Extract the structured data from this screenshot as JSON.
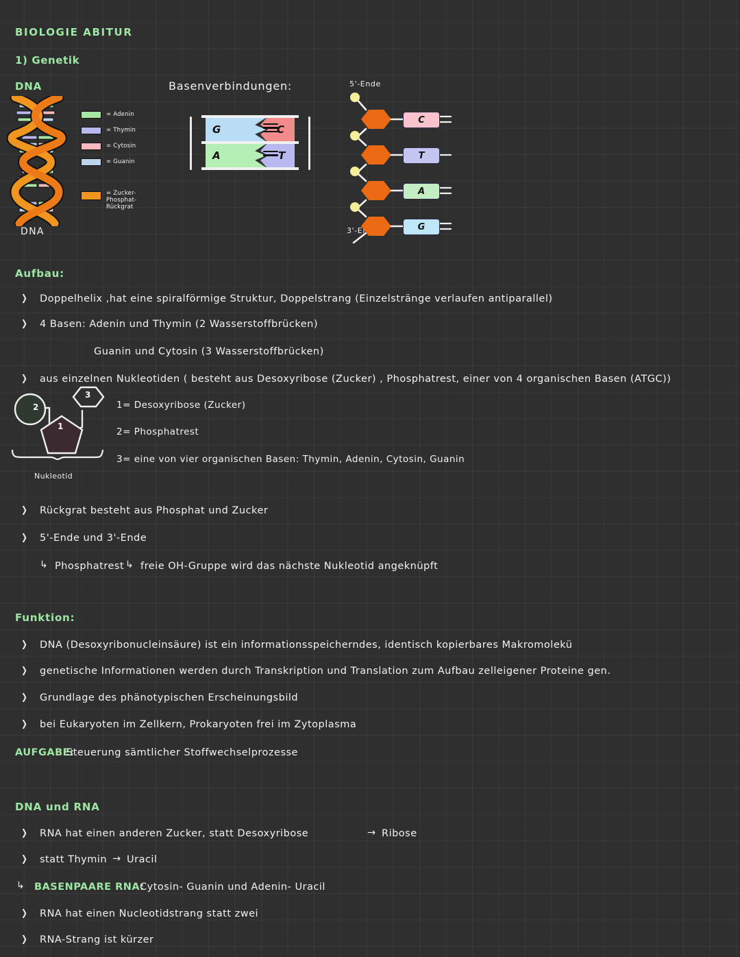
{
  "page": {
    "title": "BIOLOGIE ABITUR",
    "chapter": "1) Genetik"
  },
  "colors": {
    "background": "#2f2f2f",
    "grid_line": "#3d3d3d",
    "heading_green": "#9ee6a3",
    "text_white": "#f2f2f2",
    "adenin": "#a8e6a3",
    "thymin": "#b9b9ef",
    "cytosin": "#f5b9bf",
    "guanin": "#bcd4ec",
    "backbone_orange": "#ec6a14",
    "phosphate_yellow": "#f5ee9a",
    "cytosin_box": "#f9c3cc",
    "guanin_box": "#bfe7f7"
  },
  "dna_diagram": {
    "heading": "DNA",
    "caption": "DNA",
    "legend": [
      {
        "label": "= Adenin",
        "color": "#a8e6a3"
      },
      {
        "label": "= Thymin",
        "color": "#b9b9ef"
      },
      {
        "label": "= Cytosin",
        "color": "#f5b9bf"
      },
      {
        "label": "= Guanin",
        "color": "#bcd4ec"
      }
    ],
    "legend_backbone": {
      "label_line1": "= Zucker-",
      "label_line2": "Phosphat-",
      "label_line3": "Rückgrat",
      "color": "#f0951f"
    }
  },
  "basenverbindungen": {
    "heading": "Basenverbindungen:",
    "pairs": [
      {
        "left": "G",
        "right": "C",
        "bonds": 3,
        "left_color": "#b9ddf5",
        "right_color": "#f28b8b"
      },
      {
        "left": "A",
        "right": "T",
        "bonds": 2,
        "left_color": "#b6efb6",
        "right_color": "#b9b9ef"
      }
    ]
  },
  "nucleotide_chain": {
    "top_label": "5'-Ende",
    "bottom_label": "3'-Ende",
    "bases": [
      {
        "letter": "C",
        "color": "#f9c3cc"
      },
      {
        "letter": "T",
        "color": "#c5c5f2"
      },
      {
        "letter": "A",
        "color": "#c3eec3"
      },
      {
        "letter": "G",
        "color": "#bfe7f7"
      }
    ]
  },
  "aufbau": {
    "heading": "Aufbau:",
    "bullets": [
      "Doppelhelix ,hat eine spiralförmige  Struktur, Doppelstrang (Einzelstränge verlaufen  antiparallel)",
      "4 Basen:  Adenin  und  Thymin  (2 Wasserstoffbrücken)",
      "aus  einzelnen  Nukleotiden ( besteht  aus  Desoxyribose (Zucker) , Phosphatrest, einer  von  4 organischen  Basen (ATGC))"
    ],
    "sub_line": "Guanin  und  Cytosin  (3 Wasserstoffbrücken)",
    "nucleotide_legend": [
      "1= Desoxyribose  (Zucker)",
      "2= Phosphatrest",
      "3= eine  von  vier organischen  Basen: Thymin, Adenin, Cytosin, Guanin"
    ],
    "nucleotide_caption": "Nukleotid",
    "nucleotide_numbers": [
      "1",
      "2",
      "3"
    ],
    "bullets_after": [
      "Rückgrat besteht aus  Phosphat  und  Zucker",
      "5'-Ende  und  3'-Ende"
    ],
    "arrow_line": "Phosphatrest       freie  OH-Gruppe  wird das  nächste Nukleotid  angeknüpft",
    "arrow_line_part1": "Phosphatrest",
    "arrow_line_part2": "freie  OH-Gruppe  wird das  nächste Nukleotid  angeknüpft"
  },
  "funktion": {
    "heading": "Funktion:",
    "bullets": [
      "DNA (Desoxyribonucleinsäure) ist  ein  informationsspeicherndes, identisch  kopierbares  Makromolekü",
      "genetische  Informationen  werden  durch Transkription  und  Translation  zum  Aufbau  zelleigener  Proteine  gen.",
      "Grundlage  des  phänotypischen  Erscheinungsbild",
      "bei Eukaryoten  im  Zellkern, Prokaryoten  frei  im  Zytoplasma"
    ],
    "aufgabe_label": "AUFGABE:",
    "aufgabe_text": "Steuerung   sämtlicher   Stoffwechselprozesse"
  },
  "dna_rna": {
    "heading": "DNA und RNA",
    "bullets": [
      "RNA hat einen anderen Zucker, statt Desoxyribose",
      "statt  Thymin",
      "RNA hat einen Nucleotidstrang statt  zwei",
      "RNA-Strang ist  kürzer"
    ],
    "bullet1_after_arrow": "Ribose",
    "bullet2_after_arrow": "Uracil",
    "basenpaare_label": "BASENPAARE  RNA:",
    "basenpaare_text": "Cytosin- Guanin  und  Adenin- Uracil"
  }
}
